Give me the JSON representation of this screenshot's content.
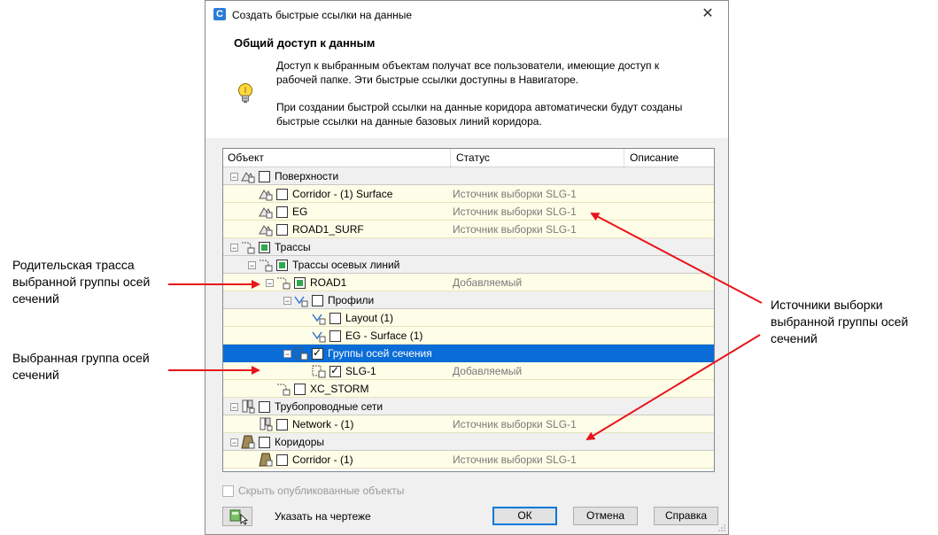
{
  "window": {
    "title": "Создать быстрые ссылки на данные",
    "close_glyph": "✕"
  },
  "header": {
    "heading": "Общий доступ к данным",
    "info1": "Доступ к выбранным объектам получат все пользователи, имеющие доступ к рабочей папке. Эти быстрые ссылки доступны в Навигаторе.",
    "info2": "При создании быстрой ссылки на данные коридора автоматически будут созданы быстрые ссылки на данные базовых линий коридора."
  },
  "grid": {
    "columns": [
      "Объект",
      "Статус",
      "Описание"
    ],
    "rows": [
      {
        "label": "Поверхности",
        "status": "",
        "icon": "surface-icon",
        "check": "empty"
      },
      {
        "label": "Corridor - (1) Surface",
        "status": "Источник выборки SLG-1",
        "icon": "surface-icon",
        "check": "empty"
      },
      {
        "label": "EG",
        "status": "Источник выборки SLG-1",
        "icon": "surface-icon",
        "check": "empty"
      },
      {
        "label": "ROAD1_SURF",
        "status": "Источник выборки SLG-1",
        "icon": "surface-icon",
        "check": "empty"
      },
      {
        "label": "Трассы",
        "status": "",
        "icon": "alignment-icon",
        "check": "partial"
      },
      {
        "label": "Трассы осевых линий",
        "status": "",
        "icon": "alignment-icon",
        "check": "partial"
      },
      {
        "label": "ROAD1",
        "status": "Добавляемый",
        "icon": "alignment-icon",
        "check": "partial"
      },
      {
        "label": "Профили",
        "status": "",
        "icon": "profile-icon",
        "check": "empty"
      },
      {
        "label": "Layout (1)",
        "status": "",
        "icon": "profile-icon",
        "check": "empty"
      },
      {
        "label": "EG - Surface (1)",
        "status": "",
        "icon": "profile-icon",
        "check": "empty"
      },
      {
        "label": "Группы осей сечения",
        "status": "",
        "icon": "sample-line-group-icon",
        "check": "checked"
      },
      {
        "label": "SLG-1",
        "status": "Добавляемый",
        "icon": "sample-line-group-icon",
        "check": "checked"
      },
      {
        "label": "XC_STORM",
        "status": "",
        "icon": "alignment-icon",
        "check": "empty"
      },
      {
        "label": "Трубопроводные сети",
        "status": "",
        "icon": "pipe-network-icon",
        "check": "empty"
      },
      {
        "label": "Network - (1)",
        "status": "Источник выборки SLG-1",
        "icon": "pipe-network-icon",
        "check": "empty"
      },
      {
        "label": "Коридоры",
        "status": "",
        "icon": "corridor-icon",
        "check": "empty"
      },
      {
        "label": "Corridor - (1)",
        "status": "Источник выборки SLG-1",
        "icon": "corridor-icon",
        "check": "empty"
      }
    ]
  },
  "footer": {
    "hide_published": "Скрыть опубликованные объекты",
    "pick_label": "Указать на чертеже",
    "ok": "ОК",
    "cancel": "Отмена",
    "help": "Справка"
  },
  "annotations": {
    "parent_alignment": "Родительская трасса выбранной группы осей сечений",
    "selected_group": "Выбранная группа осей сечений",
    "sources": "Источники выборки выбранной группы осей сечений"
  },
  "colors": {
    "selection": "#0a6cd6",
    "arrow": "#e8141a",
    "partial_check": "#2fa84f"
  }
}
